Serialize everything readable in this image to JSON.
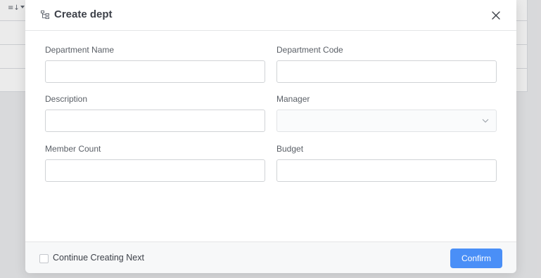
{
  "background_table": {
    "sort_icon": "≡↓"
  },
  "modal": {
    "title": "Create dept",
    "title_icon": "org-tree-icon",
    "close_icon": "close-icon"
  },
  "fields": {
    "department_name": {
      "label": "Department Name",
      "value": "",
      "placeholder": ""
    },
    "department_code": {
      "label": "Department Code",
      "value": "",
      "placeholder": ""
    },
    "description": {
      "label": "Description",
      "value": "",
      "placeholder": ""
    },
    "manager": {
      "label": "Manager",
      "selected": ""
    },
    "member_count": {
      "label": "Member Count",
      "value": "",
      "placeholder": ""
    },
    "budget": {
      "label": "Budget",
      "value": "",
      "placeholder": ""
    }
  },
  "footer": {
    "continue_label": "Continue Creating Next",
    "continue_checked": false,
    "confirm_label": "Confirm"
  },
  "colors": {
    "accent": "#4a8ff7",
    "footer_bg": "#f7f8f9",
    "border": "#d0d3d6"
  }
}
